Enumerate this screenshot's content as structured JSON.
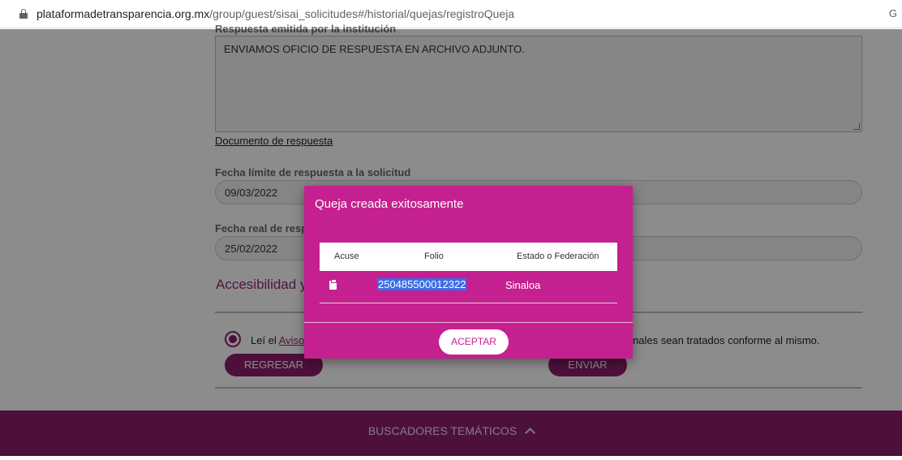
{
  "browser": {
    "url_host": "plataformadetransparencia.org.mx",
    "url_path": "/group/guest/sisai_solicitudes#/historial/quejas/registroQueja"
  },
  "form": {
    "response_label": "Respuesta emitida por la institución",
    "response_text": "ENVIAMOS OFICIO DE RESPUESTA EN ARCHIVO ADJUNTO.",
    "document_link": "Documento de respuesta",
    "deadline_label": "Fecha límite de respuesta a la solicitud",
    "deadline_value": "09/03/2022",
    "real_date_label": "Fecha real de resp",
    "real_date_value": "25/02/2022",
    "section_title": "Accesibilidad y",
    "privacy_prefix": "Leí el ",
    "privacy_link": "Aviso",
    "privacy_tail": "nales sean tratados conforme al mismo.",
    "back_button": "REGRESAR",
    "send_button": "ENVIAR"
  },
  "footer": {
    "label": "BUSCADORES TEMÁTICOS"
  },
  "modal": {
    "title": "Queja creada exitosamente",
    "columns": [
      "Acuse",
      "Folio",
      "Estado o Federación"
    ],
    "row": {
      "icon": "clipboard-icon",
      "folio": "250485500012322",
      "estado": "Sinaloa"
    },
    "accept_button": "ACEPTAR"
  },
  "colors": {
    "modal_bg": "#c5208f",
    "brand": "#8c1e6c",
    "selection": "#3a6ee8"
  }
}
